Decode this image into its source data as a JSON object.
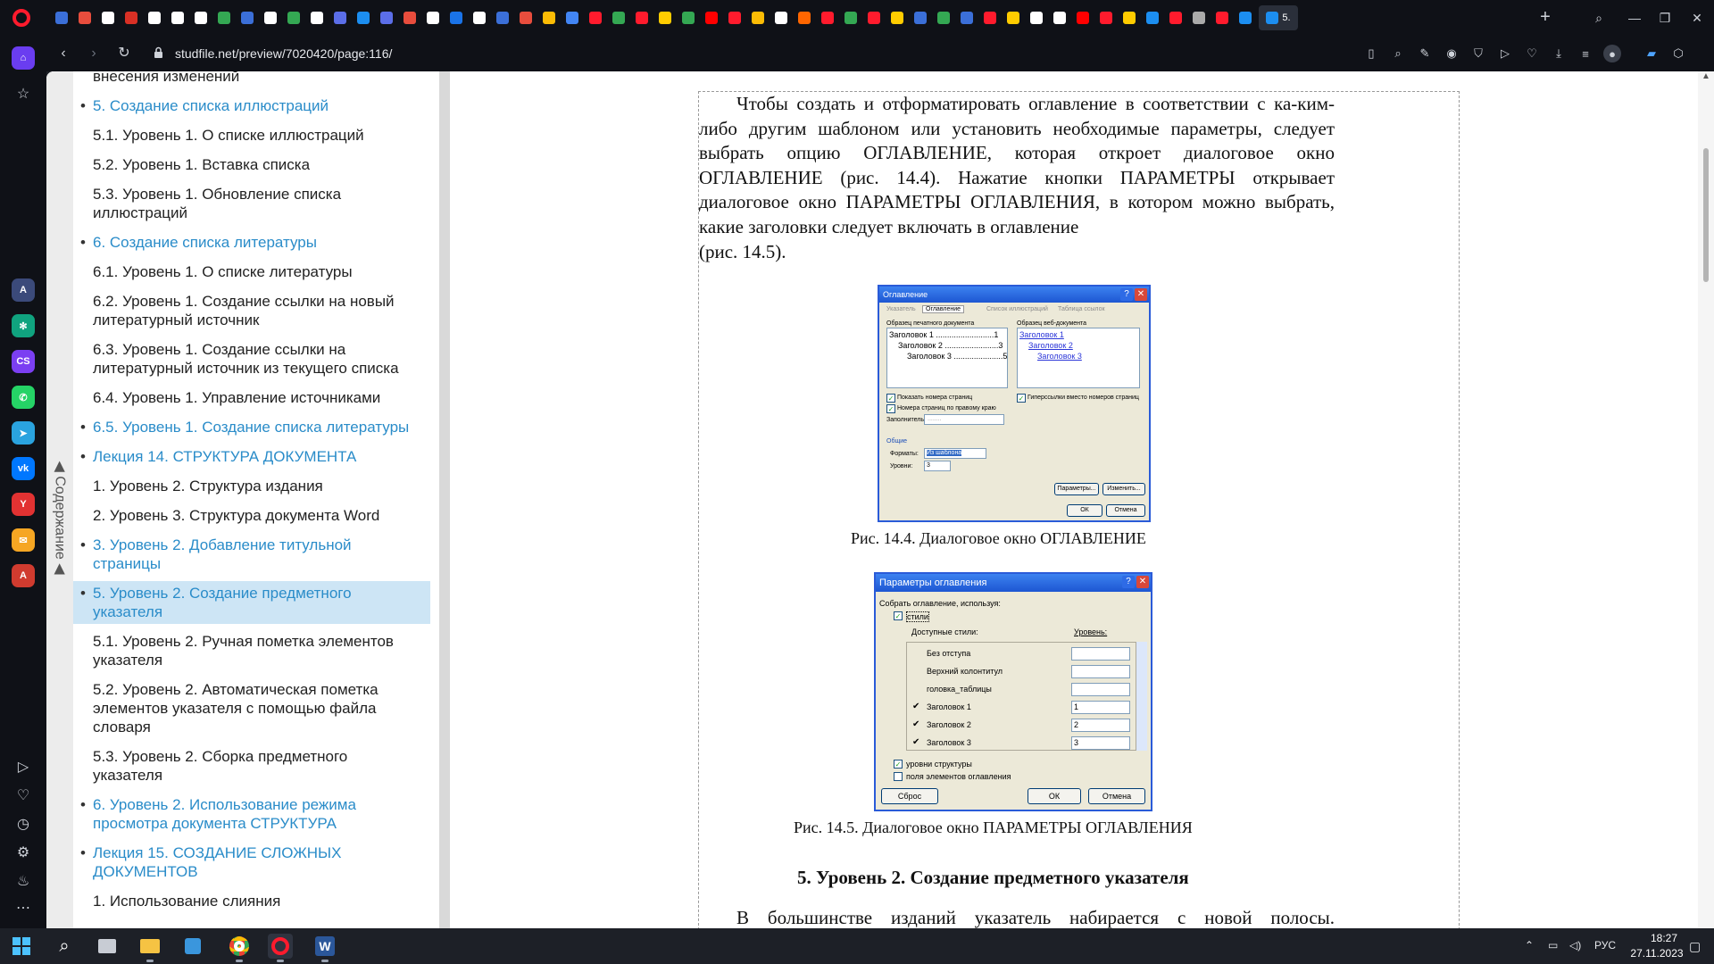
{
  "browser": {
    "url": "studfile.net/preview/7020420/page:116/",
    "active_tab_title": "5."
  },
  "toc": {
    "label": "◀ Содержание ◀",
    "items": [
      {
        "text": "внесения изменений",
        "link": false,
        "active": false
      },
      {
        "text": "5. Создание списка иллюстраций",
        "link": true,
        "active": false
      },
      {
        "text": "5.1. Уровень 1. О списке иллюстраций",
        "link": false,
        "active": false
      },
      {
        "text": "5.2. Уровень 1. Вставка списка",
        "link": false,
        "active": false
      },
      {
        "text": "5.3. Уровень 1. Обновление списка иллюстраций",
        "link": false,
        "active": false
      },
      {
        "text": "6. Создание списка литературы",
        "link": true,
        "active": false
      },
      {
        "text": "6.1. Уровень 1. О списке литературы",
        "link": false,
        "active": false
      },
      {
        "text": "6.2. Уровень 1. Создание ссылки на новый литературный источник",
        "link": false,
        "active": false
      },
      {
        "text": "6.3. Уровень 1. Создание ссылки на литературный источник из текущего списка",
        "link": false,
        "active": false
      },
      {
        "text": "6.4. Уровень 1. Управление источниками",
        "link": false,
        "active": false
      },
      {
        "text": "6.5. Уровень 1. Создание списка литературы",
        "link": true,
        "active": false
      },
      {
        "text": "Лекция 14. СТРУКТУРА ДОКУМЕНТА",
        "link": true,
        "active": false
      },
      {
        "text": "1. Уровень 2. Структура издания",
        "link": false,
        "active": false
      },
      {
        "text": "2. Уровень 3. Структура документа Word",
        "link": false,
        "active": false
      },
      {
        "text": "3. Уровень 2. Добавление титульной страницы",
        "link": true,
        "active": false
      },
      {
        "text": "5. Уровень 2. Создание предметного указателя",
        "link": true,
        "active": true
      },
      {
        "text": "5.1. Уровень 2. Ручная пометка элементов указателя",
        "link": false,
        "active": false
      },
      {
        "text": "5.2. Уровень 2. Автоматическая пометка элементов указателя с помощью файла словаря",
        "link": false,
        "active": false
      },
      {
        "text": "5.3. Уровень 2. Сборка предметного указателя",
        "link": false,
        "active": false
      },
      {
        "text": "6. Уровень 2. Использование режима просмотра документа СТРУКТУРА",
        "link": true,
        "active": false
      },
      {
        "text": "Лекция 15. СОЗДАНИЕ СЛОЖНЫХ ДОКУМЕНТОВ",
        "link": true,
        "active": false
      },
      {
        "text": "1. Использование слияния",
        "link": false,
        "active": false
      }
    ]
  },
  "document": {
    "paragraph1": "Чтобы создать и отформатировать оглавление в соответствии с ка-ким-либо другим шаблоном или установить необходимые параметры, следует выбрать опцию ОГЛАВЛЕНИЕ, которая откроет диалоговое окно ОГЛАВЛЕНИЕ (рис. 14.4). Нажатие кнопки ПАРАМЕТРЫ открывает диалоговое окно ПАРАМЕТРЫ ОГЛАВЛЕНИЯ, в котором можно выбрать, какие заголовки следует включать в оглавление",
    "paragraph1_end": "(рис. 14.5).",
    "caption1": "Рис. 14.4. Диалоговое окно ОГЛАВЛЕНИЕ",
    "caption2": "Рис. 14.5. Диалоговое окно ПАРАМЕТРЫ ОГЛАВЛЕНИЯ",
    "heading": "5. Уровень 2. Создание предметного указателя",
    "paragraph2": "В большинстве изданий указатель набирается с новой полосы."
  },
  "figure1": {
    "title": "Оглавление",
    "tabs": [
      "Указатель",
      "Оглавление",
      "Список иллюстраций",
      "Таблица ссылок"
    ],
    "print_preview_label": "Образец печатного документа",
    "web_preview_label": "Образец веб-документа",
    "print_lines": [
      "Заголовок 1 ..........................1",
      "Заголовок 2 ........................3",
      "Заголовок 3 ......................5"
    ],
    "web_lines": [
      "Заголовок 1",
      "Заголовок 2",
      "Заголовок 3"
    ],
    "chk_page_numbers": "Показать номера страниц",
    "chk_right_align": "Номера страниц по правому краю",
    "chk_hyperlinks": "Гиперссылки вместо номеров страниц",
    "filler_label": "Заполнитель:",
    "filler_value": "........",
    "general_label": "Общие",
    "formats_label": "Форматы:",
    "formats_value": "Из шаблона",
    "levels_label": "Уровни:",
    "levels_value": "3",
    "btn_params": "Параметры...",
    "btn_change": "Изменить...",
    "btn_ok": "ОК",
    "btn_cancel": "Отмена"
  },
  "figure2": {
    "title": "Параметры оглавления",
    "collect_label": "Собрать оглавление, используя:",
    "styles_label": "стили",
    "available_styles_label": "Доступные стили:",
    "level_label": "Уровень:",
    "rows": [
      {
        "style": "Без отступа",
        "checked": false,
        "level": ""
      },
      {
        "style": "Верхний колонтитул",
        "checked": false,
        "level": ""
      },
      {
        "style": "головка_таблицы",
        "checked": false,
        "level": ""
      },
      {
        "style": "Заголовок 1",
        "checked": true,
        "level": "1"
      },
      {
        "style": "Заголовок 2",
        "checked": true,
        "level": "2"
      },
      {
        "style": "Заголовок 3",
        "checked": true,
        "level": "3"
      }
    ],
    "outline_levels_label": "уровни структуры",
    "entry_fields_label": "поля элементов оглавления",
    "btn_reset": "Сброс",
    "btn_ok": "ОК",
    "btn_cancel": "Отмена"
  },
  "taskbar": {
    "lang": "РУС",
    "time": "18:27",
    "date": "27.11.2023"
  },
  "colors": {
    "link": "#2a8cc9",
    "toc_active_bg": "#cde5f5",
    "opera_red": "#ff1b2d",
    "browser_chrome": "#0f1117"
  }
}
